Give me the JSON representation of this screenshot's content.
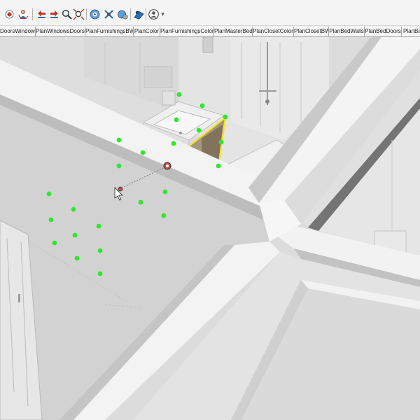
{
  "toolbar": {
    "buttons": [
      {
        "name": "record-icon",
        "color": "#c0392b"
      },
      {
        "name": "orbit-user-icon",
        "color": "#2f6fb3"
      },
      {
        "name": "previous-view-icon",
        "color": "#c0392b"
      },
      {
        "name": "next-view-icon",
        "color": "#c0392b"
      },
      {
        "name": "zoom-icon",
        "color": "#2f6fb3"
      },
      {
        "name": "zoom-extents-icon",
        "color": "#c0392b"
      },
      {
        "name": "section-plane-icon",
        "color": "#2f6fb3"
      },
      {
        "name": "walk-icon",
        "color": "#2f6fb3"
      },
      {
        "name": "look-around-icon",
        "color": "#2f6fb3"
      },
      {
        "name": "position-camera-icon",
        "color": "#2f6fb3"
      },
      {
        "name": "user-account-icon",
        "color": "#555555"
      }
    ],
    "dropdown_glyph": "▾"
  },
  "scene_tabs": [
    {
      "label": "DoorsWindows"
    },
    {
      "label": "PlanWindowsDoors"
    },
    {
      "label": "PlanFurnishingsBW"
    },
    {
      "label": "PlanColor"
    },
    {
      "label": "PlanFurnishingsColor"
    },
    {
      "label": "PlanMasterBed"
    },
    {
      "label": "PlanClosetColor"
    },
    {
      "label": "PlanClosetBW"
    },
    {
      "label": "PlanBedWalls"
    },
    {
      "label": "PlanBedDoors"
    },
    {
      "label": "PlanBa"
    }
  ],
  "colors": {
    "marker_green": "#2ee82e",
    "selection_yellow": "#f2e61c",
    "wall_top": "#f3f3f3",
    "floor": "#d2d2d2"
  }
}
